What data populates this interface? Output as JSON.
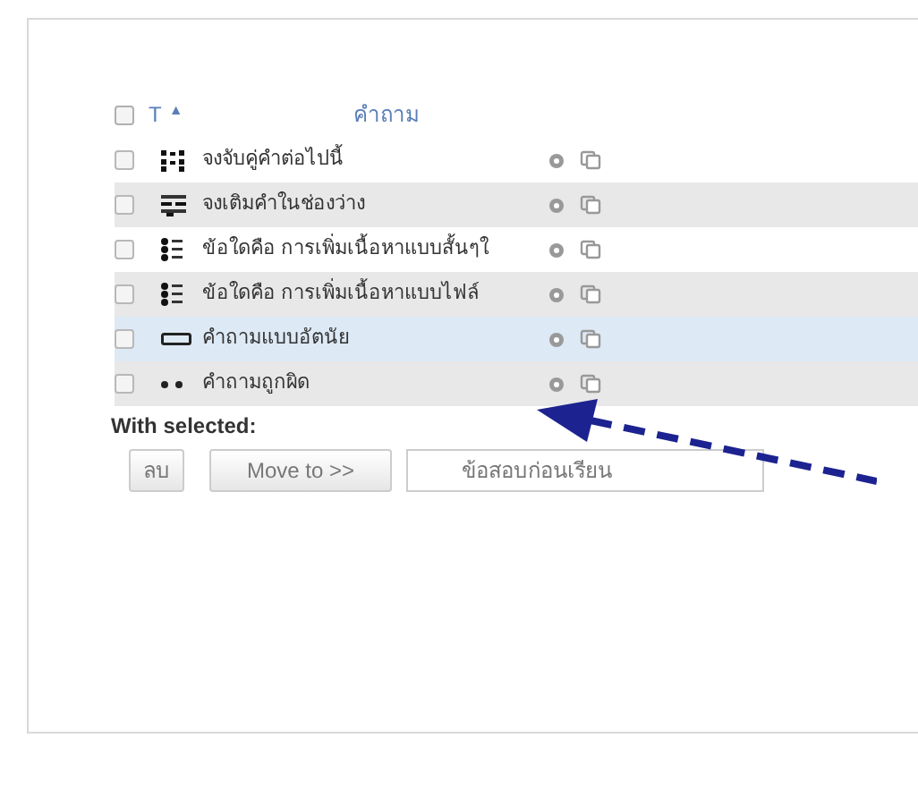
{
  "table": {
    "select_all_checked": false,
    "columns": [
      {
        "label": "T",
        "sort": "▲"
      },
      {
        "label": "คำถาม"
      }
    ],
    "rows": [
      {
        "kind": "match",
        "text": "จงจับคู่คำต่อไปนี้",
        "checked": false,
        "selected": false
      },
      {
        "kind": "gapfill",
        "text": "จงเติมคำในช่องว่าง",
        "checked": false,
        "selected": false
      },
      {
        "kind": "multichoice",
        "text": "ข้อใดคือ การเพิ่มเนื้อหาแบบสั้นๆใ",
        "checked": false,
        "selected": false
      },
      {
        "kind": "multichoice",
        "text": "ข้อใดคือ การเพิ่มเนื้อหาแบบไฟล์",
        "checked": false,
        "selected": false
      },
      {
        "kind": "essay",
        "text": "คำถามแบบอัตนัย",
        "checked": false,
        "selected": true
      },
      {
        "kind": "truefalse",
        "text": "คำถามถูกผิด",
        "checked": false,
        "selected": false
      }
    ]
  },
  "with_selected": {
    "label": "With selected:",
    "buttons": [
      "ลบ",
      "Move to >>"
    ],
    "category": "ข้อสอบก่อนเรียน"
  }
}
